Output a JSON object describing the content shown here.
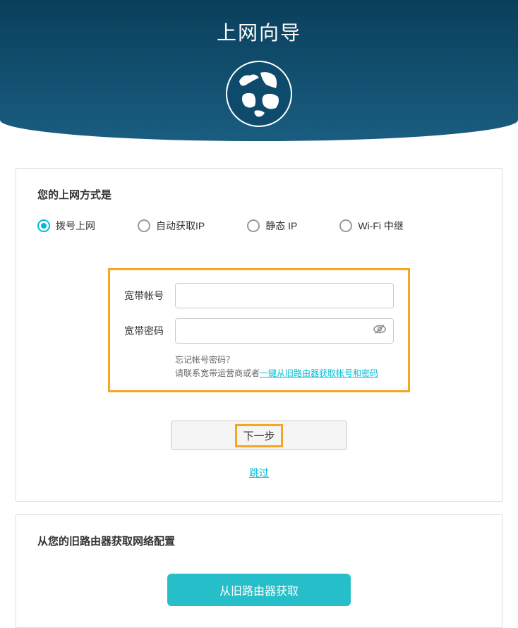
{
  "header": {
    "title": "上网向导"
  },
  "card1": {
    "section_title": "您的上网方式是",
    "radio_options": [
      {
        "label": "拨号上网",
        "selected": true
      },
      {
        "label": "自动获取IP",
        "selected": false
      },
      {
        "label": "静态 IP",
        "selected": false
      },
      {
        "label": "Wi-Fi 中继",
        "selected": false
      }
    ],
    "form": {
      "account_label": "宽带帐号",
      "account_value": "",
      "password_label": "宽带密码",
      "password_value": "",
      "hint_line1": "忘记帐号密码？",
      "hint_line2_prefix": "请联系宽带运营商或者",
      "hint_link": "一键从旧路由器获取帐号和密码"
    },
    "next_button": "下一步",
    "skip_link": "跳过"
  },
  "card2": {
    "section_title": "从您的旧路由器获取网络配置",
    "fetch_button": "从旧路由器获取"
  },
  "icons": {
    "globe": "globe-icon",
    "eye": "eye-icon"
  }
}
